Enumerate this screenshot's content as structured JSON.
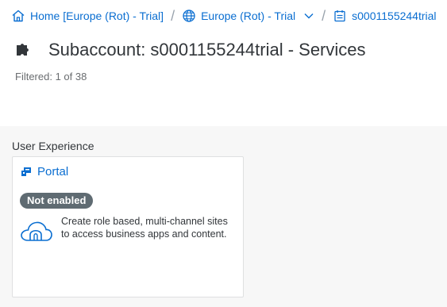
{
  "breadcrumb": {
    "home_label": "Home [Europe (Rot) - Trial]",
    "region_label": "Europe (Rot) - Trial",
    "subaccount_label": "s0001155244trial",
    "separator": "/"
  },
  "header": {
    "title": "Subaccount: s0001155244trial - Services",
    "filtered_text": "Filtered: 1 of 38"
  },
  "group": {
    "label": "User Experience"
  },
  "tile": {
    "name": "Portal",
    "status": "Not enabled",
    "description": "Create role based, multi-channel sites to access business apps and content."
  },
  "colors": {
    "link": "#0a6ed1",
    "badge_bg": "#5f6b72",
    "content_bg": "#f7f7f7"
  },
  "icons": {
    "home": "home-icon",
    "globe": "globe-icon",
    "chevron": "chevron-down-icon",
    "subaccount": "subaccount-icon",
    "puzzle": "puzzle-icon",
    "portal": "portal-icon",
    "cloud": "cloud-icon"
  }
}
